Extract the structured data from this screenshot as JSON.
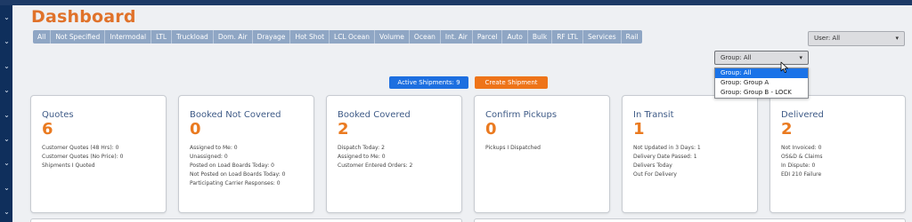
{
  "header": {
    "title": "Dashboard"
  },
  "tabs": [
    "All",
    "Not Specified",
    "Intermodal",
    "LTL",
    "Truckload",
    "Dom. Air",
    "Drayage",
    "Hot Shot",
    "LCL Ocean",
    "Volume",
    "Ocean",
    "Int. Air",
    "Parcel",
    "Auto",
    "Bulk",
    "RF LTL",
    "Services",
    "Rail"
  ],
  "filters": {
    "user_select": "User: All",
    "group_select": "Group: All",
    "group_options": [
      "Group: All",
      "Group: Group A",
      "Group: Group B - LOCK"
    ],
    "group_selected_index": 0
  },
  "actions": {
    "active_shipments": "Active Shipments: 9",
    "create_shipment": "Create Shipment"
  },
  "cards": [
    {
      "title": "Quotes",
      "value": "6",
      "lines": [
        "Customer Quotes (48 Hrs): 0",
        "Customer Quotes (No Price): 0",
        "Shipments I Quoted"
      ]
    },
    {
      "title": "Booked Not Covered",
      "value": "0",
      "lines": [
        "Assigned to Me: 0",
        "Unassigned: 0",
        "Posted on Load Boards Today: 0",
        "Not Posted on Load Boards Today: 0",
        "Participating Carrier Responses: 0"
      ]
    },
    {
      "title": "Booked Covered",
      "value": "2",
      "lines": [
        "Dispatch Today: 2",
        "Assigned to Me: 0",
        "Customer Entered Orders: 2"
      ]
    },
    {
      "title": "Confirm Pickups",
      "value": "0",
      "lines": [
        "Pickups I Dispatched"
      ]
    },
    {
      "title": "In Transit",
      "value": "1",
      "lines": [
        "Not Updated in 3 Days: 1",
        "Delivery Date Passed: 1",
        "Delivers Today",
        "Out For Delivery"
      ]
    },
    {
      "title": "Delivered",
      "value": "2",
      "lines": [
        "Not Invoiced: 0",
        "OS&D & Claims",
        "In Dispute: 0",
        "EDI 210 Failure"
      ]
    }
  ],
  "colors": {
    "accent_orange": "#ea7a20",
    "primary_blue": "#1d6fe0",
    "tab_bg": "#8fa6c4",
    "sidebar": "#0f2f5c"
  }
}
